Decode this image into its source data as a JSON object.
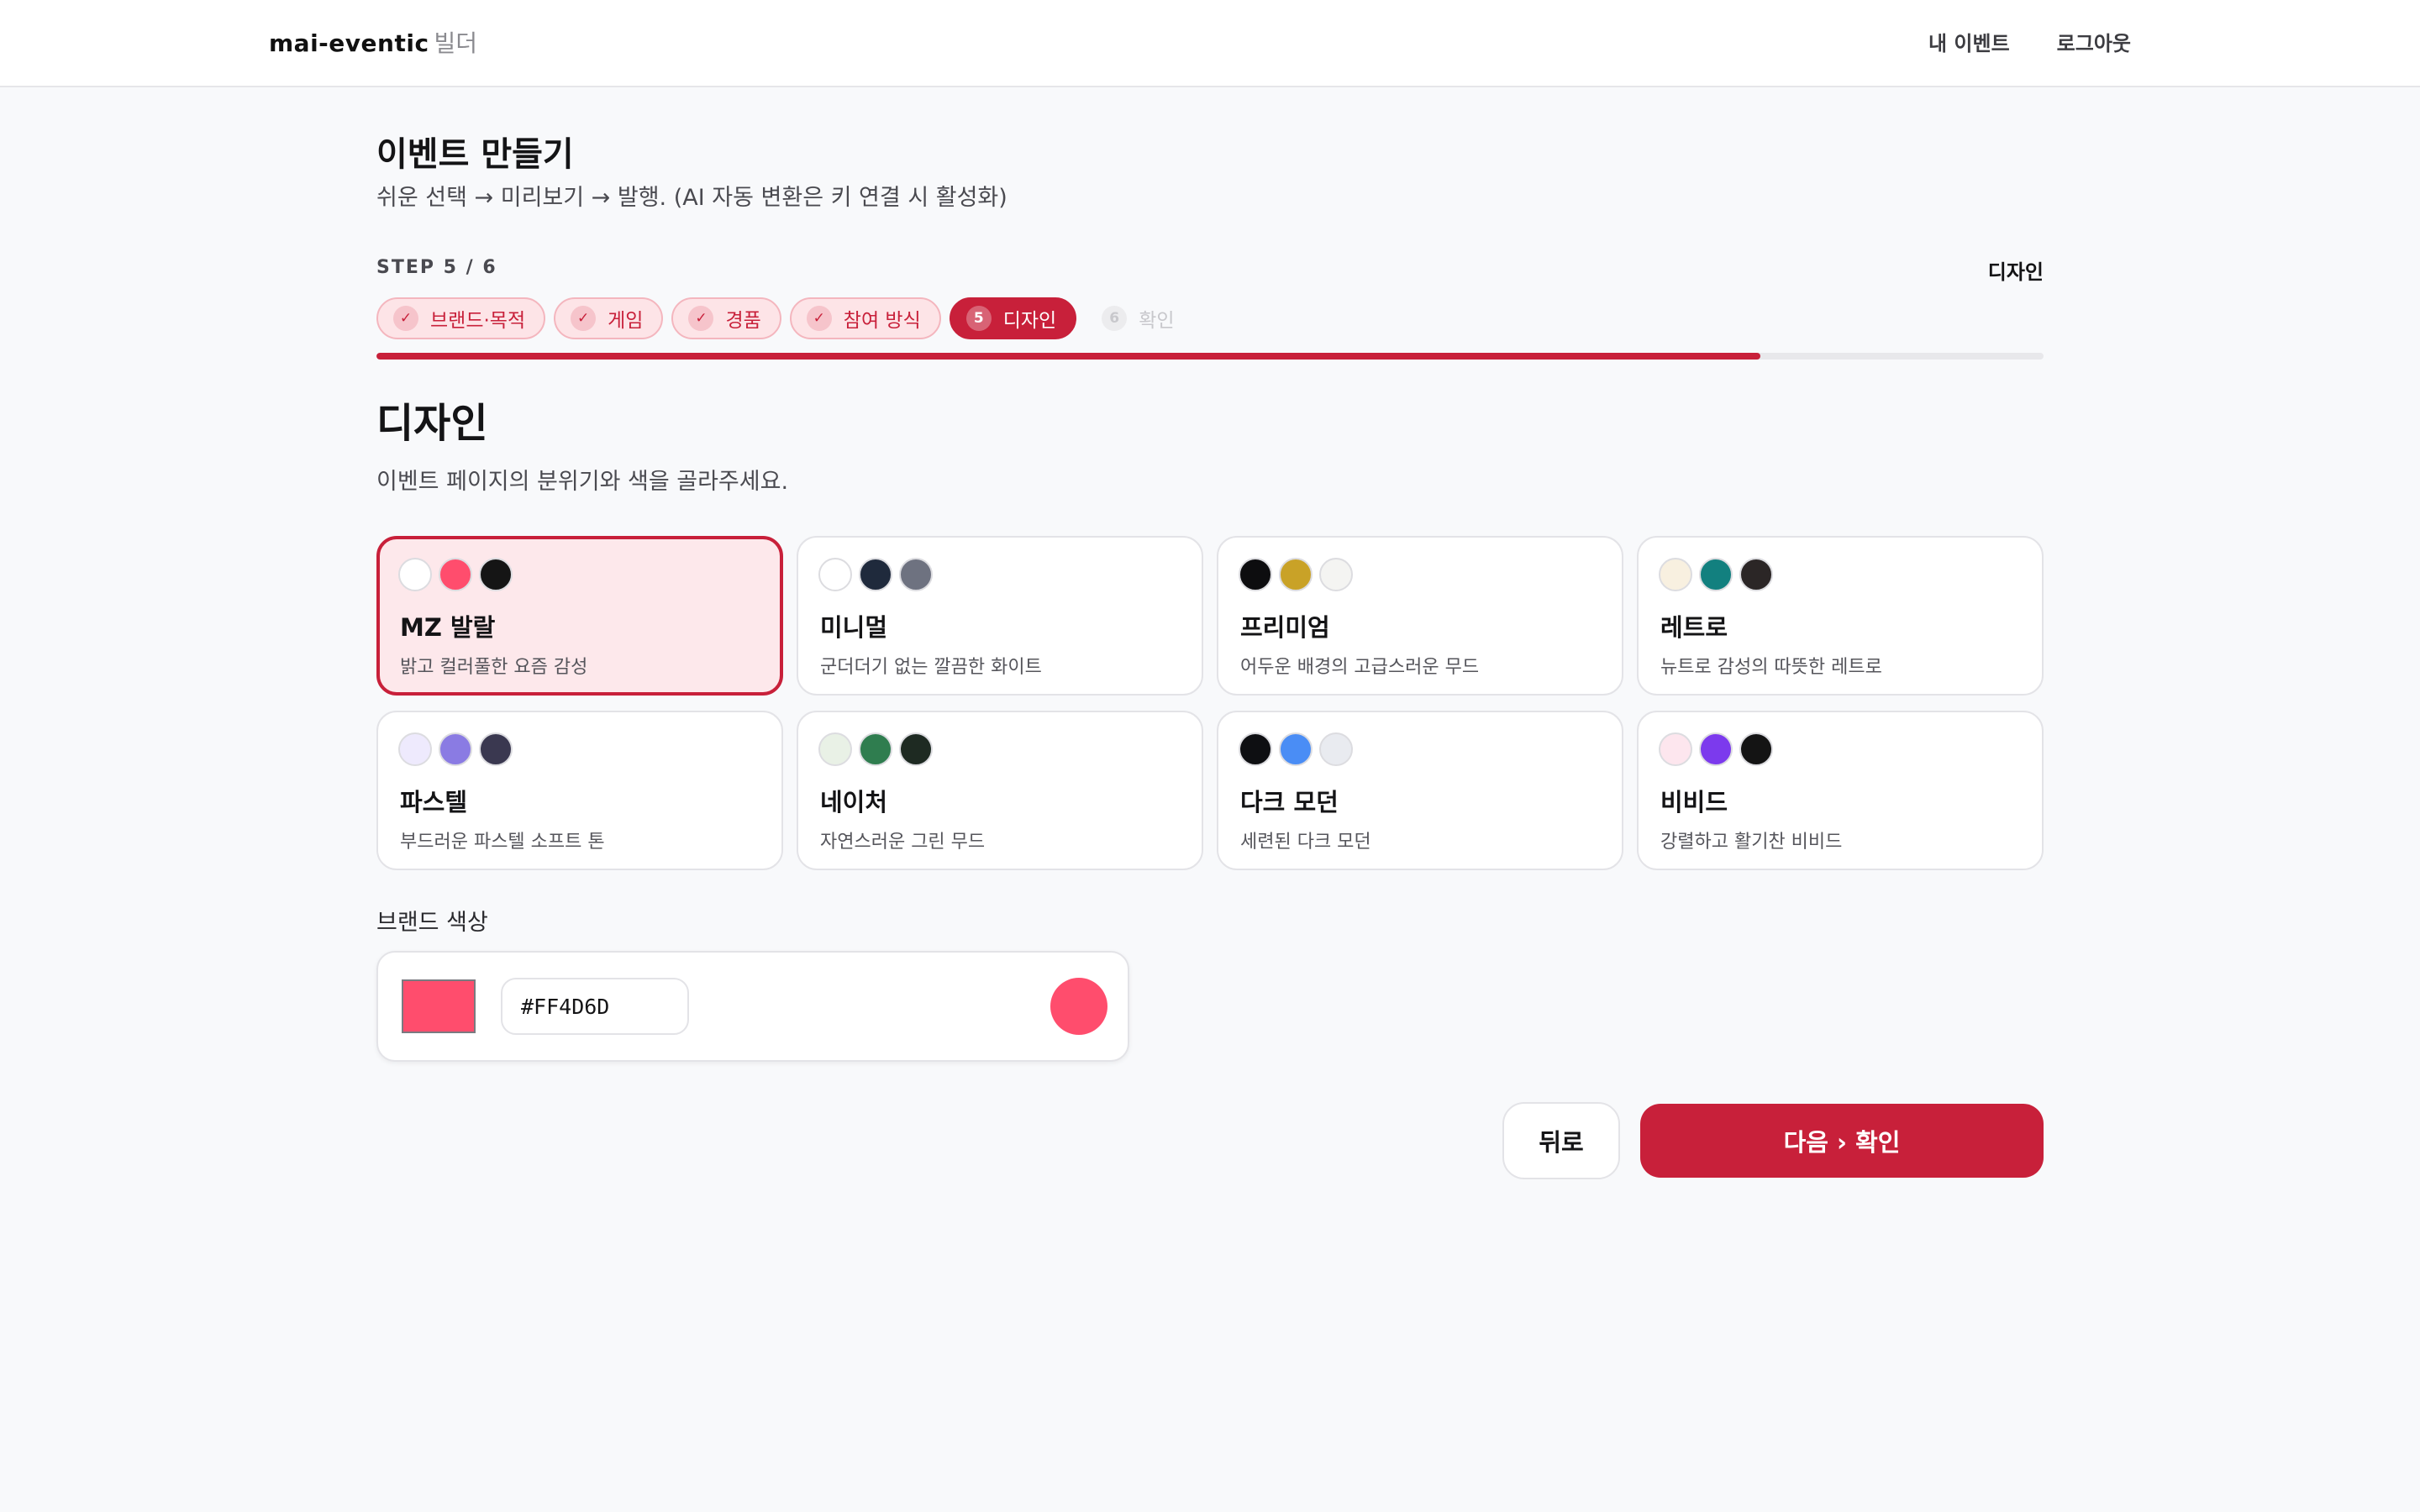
{
  "header": {
    "brand_name": "mai-eventic",
    "brand_sub": "빌더",
    "nav": [
      "내 이벤트",
      "로그아웃"
    ]
  },
  "page": {
    "title": "이벤트 만들기",
    "subtitle": "쉬운 선택 → 미리보기 → 발행. (AI 자동 변환은 키 연결 시 활성화)"
  },
  "stepper": {
    "label": "STEP 5 / 6",
    "current_name": "디자인",
    "current": 5,
    "total": 6,
    "progress": 0.83,
    "steps": [
      {
        "mark": "✓",
        "label": "브랜드·목적",
        "state": "done"
      },
      {
        "mark": "✓",
        "label": "게임",
        "state": "done"
      },
      {
        "mark": "✓",
        "label": "경품",
        "state": "done"
      },
      {
        "mark": "✓",
        "label": "참여 방식",
        "state": "done"
      },
      {
        "mark": "5",
        "label": "디자인",
        "state": "active"
      },
      {
        "mark": "6",
        "label": "확인",
        "state": "future"
      }
    ]
  },
  "section": {
    "title": "디자인",
    "subtitle": "이벤트 페이지의 분위기와 색을 골라주세요."
  },
  "themes": [
    {
      "name": "MZ 발랄",
      "desc": "밝고 컬러풀한 요즘 감성",
      "colors": [
        "#FFFFFF",
        "#FF4D6D",
        "#151515"
      ],
      "selected": true
    },
    {
      "name": "미니멀",
      "desc": "군더더기 없는 깔끔한 화이트",
      "colors": [
        "#FFFFFF",
        "#1F2A3C",
        "#6E7280"
      ],
      "selected": false
    },
    {
      "name": "프리미엄",
      "desc": "어두운 배경의 고급스러운 무드",
      "colors": [
        "#0D0D0F",
        "#C9A227",
        "#F4F4F2"
      ],
      "selected": false
    },
    {
      "name": "레트로",
      "desc": "뉴트로 감성의 따뜻한 레트로",
      "colors": [
        "#F8F0E0",
        "#12807F",
        "#2B2626"
      ],
      "selected": false
    },
    {
      "name": "파스텔",
      "desc": "부드러운 파스텔 소프트 톤",
      "colors": [
        "#EEEAFD",
        "#8A7BE3",
        "#3A3850"
      ],
      "selected": false
    },
    {
      "name": "네이처",
      "desc": "자연스러운 그린 무드",
      "colors": [
        "#E9F1E6",
        "#2F7D4F",
        "#1E2A22"
      ],
      "selected": false
    },
    {
      "name": "다크 모던",
      "desc": "세련된 다크 모던",
      "colors": [
        "#0E0F12",
        "#4A8DF5",
        "#E9EBF0"
      ],
      "selected": false
    },
    {
      "name": "비비드",
      "desc": "강렬하고 활기찬 비비드",
      "colors": [
        "#FDE6EE",
        "#7C3AED",
        "#141414"
      ],
      "selected": false
    }
  ],
  "brand_color": {
    "label": "브랜드 색상",
    "value": "#FF4D6D"
  },
  "actions": {
    "back_label": "뒤로",
    "next_label": "다음 › 확인"
  },
  "colors": {
    "accent": "#C8203A",
    "accent_light": "#FDE4E7"
  }
}
